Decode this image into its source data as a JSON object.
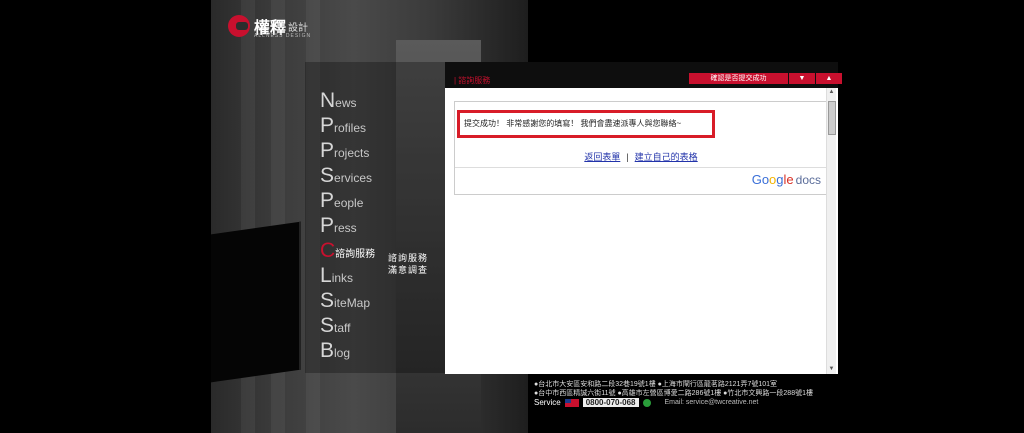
{
  "brand": {
    "name": "權釋",
    "sub": "設計",
    "tagline": "ALLNESS DESIGN"
  },
  "nav": [
    {
      "cap": "N",
      "rest": "ews"
    },
    {
      "cap": "P",
      "rest": "rofiles"
    },
    {
      "cap": "P",
      "rest": "rojects"
    },
    {
      "cap": "S",
      "rest": "ervices"
    },
    {
      "cap": "P",
      "rest": "eople"
    },
    {
      "cap": "P",
      "rest": "ress"
    },
    {
      "cap": "C",
      "rest": "諮詢服務",
      "active": true
    },
    {
      "cap": "L",
      "rest": "inks"
    },
    {
      "cap": "S",
      "rest": "iteMap"
    },
    {
      "cap": "S",
      "rest": "taff"
    },
    {
      "cap": "B",
      "rest": "log"
    }
  ],
  "subnav": [
    "諮詢服務",
    "滿意調查"
  ],
  "header": {
    "title": "| 諮詢服務",
    "check_button": "確認是否提交成功",
    "down_button": "▼",
    "up_button": "▲"
  },
  "form": {
    "message": "提交成功！ 非常感謝您的填寫！ 我們會盡速派專人與您聯絡~",
    "link_back": "返回表單",
    "separator": "|",
    "link_create": "建立自己的表格",
    "google_docs": {
      "g": "Go",
      "o": "o",
      "g2": "g",
      "le": "le",
      "docs": "docs"
    }
  },
  "scroll": {
    "up": "▲",
    "down": "▼"
  },
  "footer": {
    "line1": "●台北市大安區安和路二段32巷19號1樓  ●上海市閘行區龍茗路2121弄7號101室",
    "line2": "●台中市西區精誠六街11號  ●高雄市左營區博愛二路286號1樓  ●竹北市文興路一段288號1樓",
    "service": "Service",
    "phone": "0800-070-068",
    "email": "Email: service@twcreative.net"
  }
}
